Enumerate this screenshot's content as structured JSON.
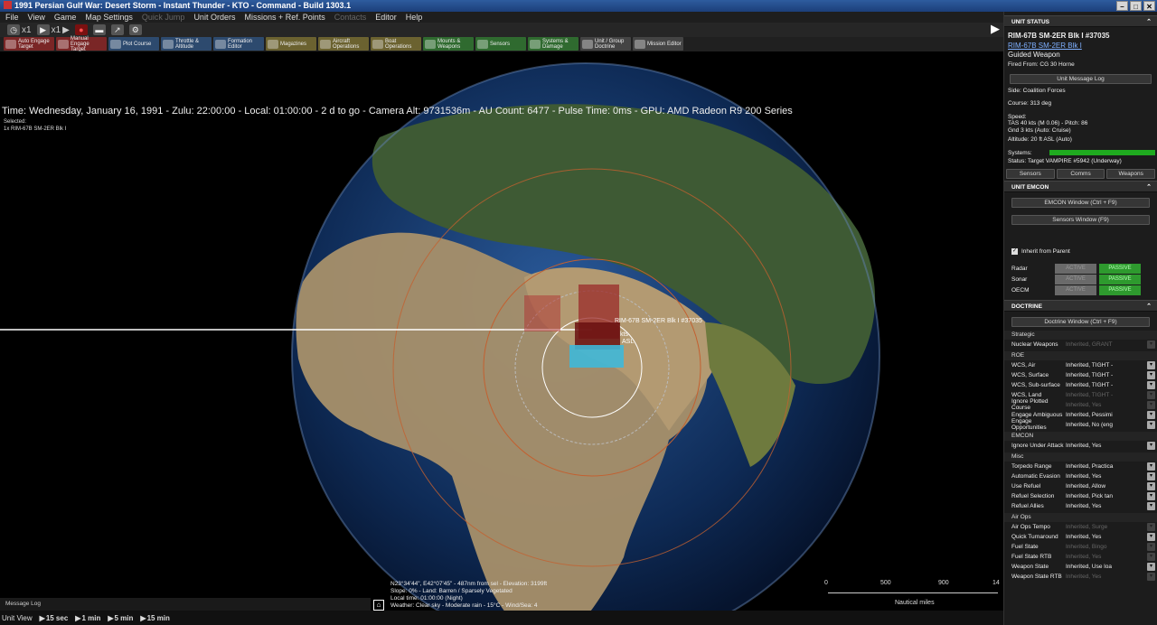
{
  "window": {
    "title": "1991 Persian Gulf War: Desert Storm - Instant Thunder - KTO - Command - Build 1303.1",
    "controls": [
      "–",
      "□",
      "✕"
    ]
  },
  "menu": [
    {
      "label": "File",
      "enabled": true
    },
    {
      "label": "View",
      "enabled": true
    },
    {
      "label": "Game",
      "enabled": true
    },
    {
      "label": "Map Settings",
      "enabled": true
    },
    {
      "label": "Quick Jump",
      "enabled": false
    },
    {
      "label": "Unit Orders",
      "enabled": true
    },
    {
      "label": "Missions + Ref. Points",
      "enabled": true
    },
    {
      "label": "Contacts",
      "enabled": false
    },
    {
      "label": "Editor",
      "enabled": true
    },
    {
      "label": "Help",
      "enabled": true
    }
  ],
  "toolbar1": {
    "speed1": "x1",
    "speed2": "x1"
  },
  "toolbar2": [
    {
      "label": "Auto Engage Target",
      "color": "red",
      "icon": "auto-engage-icon"
    },
    {
      "label": "Manual Engage Target",
      "color": "red",
      "icon": "manual-engage-icon"
    },
    {
      "label": "Plot Course",
      "color": "blue",
      "icon": "plot-course-icon"
    },
    {
      "label": "Throttle & Altitude",
      "color": "blue",
      "icon": "throttle-icon"
    },
    {
      "label": "Formation Editor",
      "color": "blue",
      "icon": "formation-icon"
    },
    {
      "label": "Magazines",
      "color": "olive",
      "icon": "magazines-icon"
    },
    {
      "label": "Aircraft Operations",
      "color": "olive",
      "icon": "aircraft-ops-icon"
    },
    {
      "label": "Boat Operations",
      "color": "olive",
      "icon": "boat-ops-icon"
    },
    {
      "label": "Mounts & Weapons",
      "color": "green",
      "icon": "mounts-icon"
    },
    {
      "label": "Sensors",
      "color": "green",
      "icon": "sensors-icon"
    },
    {
      "label": "Systems & Damage",
      "color": "green",
      "icon": "systems-icon"
    },
    {
      "label": "Unit / Group Doctrine",
      "color": "gray",
      "icon": "doctrine-icon"
    },
    {
      "label": "Mission Editor",
      "color": "gray",
      "icon": "mission-editor-icon"
    }
  ],
  "status": {
    "line": "Time: Wednesday, January 16, 1991 - Zulu: 22:00:00 - Local: 01:00:00 - 2 d to go -  Camera Alt: 9731536m - AU Count: 6477 - Pulse Time: 0ms - GPU: AMD Radeon R9 200 Series"
  },
  "selection": {
    "label": "Selected:",
    "item": "1x RIM-67B SM-2ER Blk I"
  },
  "map_labels": {
    "unit": "RIM-67B SM-2ER Blk I #37035",
    "alt": "ASL",
    "kts": "kts"
  },
  "cursor": {
    "lines": [
      "N23°34'44\", E42°07'45\" - 487nm from sel - Elevation: 3199ft",
      "Slope: 0% - Land: Barren / Sparsely Vegetated",
      "Local time: 01:00:00 (Night)",
      "Weather: Clear sky - Moderate rain - 15°C - Wind/Sea: 4"
    ]
  },
  "scale": {
    "ticks": [
      "0",
      "500",
      "900",
      "14"
    ],
    "units": "Nautical miles"
  },
  "message_log": "Message Log",
  "bottom": {
    "label": "Unit View",
    "steps": [
      "15 sec",
      "1 min",
      "5 min",
      "15 min"
    ]
  },
  "panel": {
    "unit_status_title": "UNIT STATUS",
    "unit_name": "RIM-67B SM-2ER Blk I #37035",
    "unit_link": "RIM-67B SM-2ER Blk I",
    "unit_type": "Guided Weapon",
    "fired_from": "Fired From: CG 30 Horne",
    "message_log_btn": "Unit Message Log",
    "side": "Side: Coalition Forces",
    "course": "Course: 313 deg",
    "speed_label": "Speed:",
    "speed_tas": "TAS 40 kts (M 0.06) - Pitch: 86",
    "speed_gnd": "Gnd 3 kts (Auto: Cruise)",
    "altitude": "Altitude: 20 ft ASL (Auto)",
    "systems_label": "Systems:",
    "systems_level": 1.0,
    "status_line": "Status: Target VAMPIRE #5942 (Underway)",
    "tabs": [
      "Sensors",
      "Comms",
      "Weapons"
    ],
    "emcon_title": "UNIT EMCON",
    "emcon_window_btn": "EMCON Window (Ctrl + F9)",
    "sensors_window_btn": "Sensors Window (F9)",
    "inherit": "Inherit from Parent",
    "emcon": [
      {
        "label": "Radar"
      },
      {
        "label": "Sonar"
      },
      {
        "label": "OECM"
      }
    ],
    "active": "ACTIVE",
    "passive": "PASSIVE",
    "doctrine_title": "DOCTRINE",
    "doctrine_window_btn": "Doctrine Window (Ctrl + F9)",
    "doctrine": [
      {
        "section": "Strategic",
        "rows": [
          {
            "label": "Nuclear Weapons",
            "value": "Inherited, GRANT",
            "dim": true
          }
        ]
      },
      {
        "section": "ROE",
        "rows": [
          {
            "label": "WCS, Air",
            "value": "Inherited, TIGHT -",
            "dim": false
          },
          {
            "label": "WCS, Surface",
            "value": "Inherited, TIGHT -",
            "dim": false
          },
          {
            "label": "WCS, Sub-surface",
            "value": "Inherited, TIGHT -",
            "dim": false
          },
          {
            "label": "WCS, Land",
            "value": "Inherited, TIGHT -",
            "dim": true
          },
          {
            "label": "Ignore Plotted Course",
            "value": "Inherited, Yes",
            "dim": true
          },
          {
            "label": "Engage Ambiguous",
            "value": "Inherited, Pessimi",
            "dim": false
          },
          {
            "label": "Engage Opportunities",
            "value": "Inherited, No (eng",
            "dim": false
          }
        ]
      },
      {
        "section": "EMCON",
        "rows": [
          {
            "label": "Ignore Under Attack",
            "value": "Inherited, Yes",
            "dim": false
          }
        ]
      },
      {
        "section": "Misc",
        "rows": [
          {
            "label": "Torpedo Range",
            "value": "Inherited, Practica",
            "dim": false
          },
          {
            "label": "Automatic Evasion",
            "value": "Inherited, Yes",
            "dim": false
          },
          {
            "label": "Use Refuel",
            "value": "Inherited, Allow",
            "dim": false
          },
          {
            "label": "Refuel Selection",
            "value": "Inherited, Pick tan",
            "dim": false
          },
          {
            "label": "Refuel Allies",
            "value": "Inherited, Yes",
            "dim": false
          }
        ]
      },
      {
        "section": "Air Ops",
        "rows": [
          {
            "label": "Air Ops Tempo",
            "value": "Inherited, Surge",
            "dim": true
          },
          {
            "label": "Quick Turnaround",
            "value": "Inherited, Yes",
            "dim": false
          },
          {
            "label": "Fuel State",
            "value": "Inherited, Bingo",
            "dim": true
          },
          {
            "label": "Fuel State RTB",
            "value": "Inherited, Yes",
            "dim": true
          },
          {
            "label": "Weapon State",
            "value": "Inherited, Use loa",
            "dim": false
          },
          {
            "label": "Weapon State RTB",
            "value": "Inherited, Yes",
            "dim": true
          }
        ]
      }
    ]
  }
}
